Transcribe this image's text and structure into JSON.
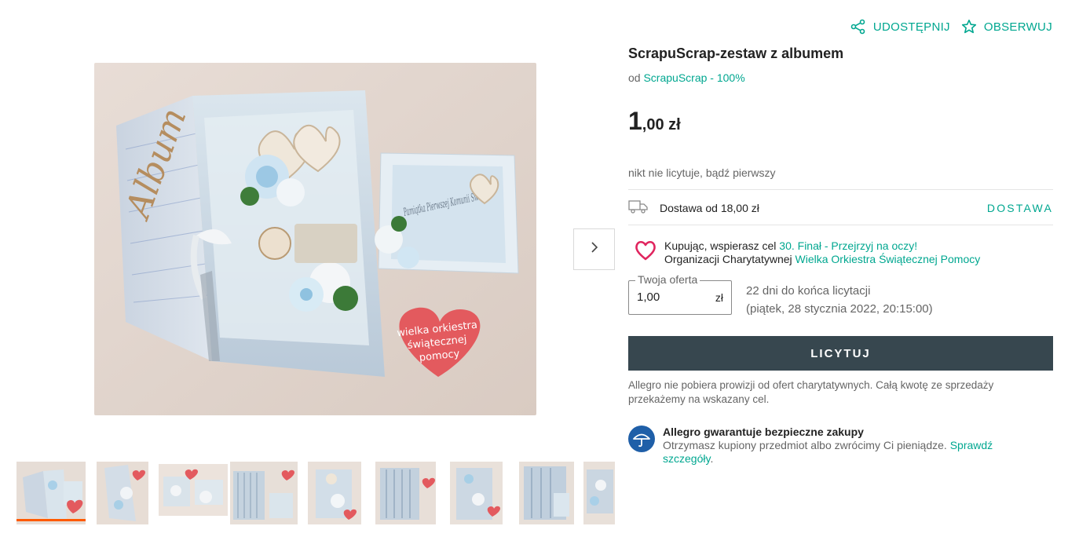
{
  "actions": {
    "share_label": "UDOSTĘPNIJ",
    "watch_label": "OBSERWUJ",
    "share_icon": "share-icon",
    "watch_icon": "star-icon"
  },
  "product": {
    "title": "ScrapuScrap-zestaw z albumem",
    "seller_prefix": "od",
    "seller_name": "ScrapuScrap - 100%"
  },
  "price": {
    "integer": "1",
    "decimal": ",00 zł"
  },
  "bids_text": "nikt nie licytuje, bądź pierwszy",
  "delivery": {
    "icon": "truck-icon",
    "label": "Dostawa od 18,00 zł",
    "link": "DOSTAWA"
  },
  "charity": {
    "icon": "heart-icon",
    "line1_prefix": "Kupując, wspierasz cel",
    "line1_link": "30. Finał - Przejrzyj na oczy!",
    "line2_prefix": "Organizacji Charytatywnej",
    "line2_link": "Wielka Orkiestra Świątecznej Pomocy"
  },
  "offer": {
    "legend": "Twoja oferta",
    "value": "1,00",
    "currency": "zł"
  },
  "deadline": {
    "line1": "22 dni do końca licytacji",
    "line2": "(piątek, 28 stycznia 2022, 20:15:00)"
  },
  "bid_button": "LICYTUJ",
  "note": "Allegro nie pobiera prowizji od ofert charytatywnych. Całą kwotę ze sprzedaży przekażemy na wskazany cel.",
  "guarantee": {
    "icon": "umbrella-icon",
    "heading": "Allegro gwarantuje bezpieczne zakupy",
    "body": "Otrzymasz kupiony przedmiot albo zwrócimy Ci pieniądze.",
    "link": "Sprawdź szczegóły",
    "end": "."
  },
  "gallery": {
    "next_icon": "chevron-right-icon",
    "badge_line1": "wielka orkiestra",
    "badge_line2": "świątecznej",
    "badge_line3": "pomocy",
    "album_text": "Album",
    "card_text": "Pamiątka Pierwszej Komunii Świętej",
    "thumbnail_count": 9,
    "active_thumbnail": 1
  },
  "colors": {
    "accent": "#00a790",
    "button": "#37474f",
    "active_thumb": "#ff5a00",
    "charity_heart": "#e0245e"
  }
}
